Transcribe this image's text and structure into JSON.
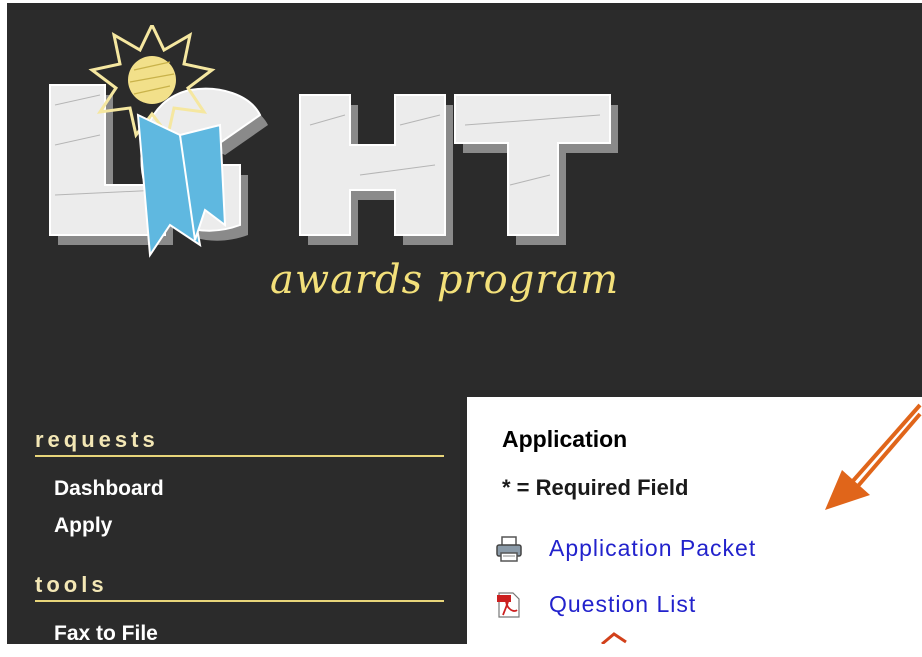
{
  "logo": {
    "title": "LIGHT",
    "subtitle": "awards program"
  },
  "sidebar": {
    "sections": [
      {
        "heading": "requests",
        "items": [
          "Dashboard",
          "Apply"
        ]
      },
      {
        "heading": "tools",
        "items": [
          "Fax to File"
        ]
      }
    ]
  },
  "panel": {
    "title": "Application",
    "required_note": "* = Required Field",
    "links": [
      {
        "label": "Application Packet",
        "icon": "printer-icon"
      },
      {
        "label": "Question List",
        "icon": "pdf-icon"
      }
    ]
  },
  "colors": {
    "background": "#2b2b2b",
    "heading": "#f3e7b5",
    "rule": "#e8d57a",
    "link": "#2222cc",
    "arrow": "#e0651a"
  }
}
